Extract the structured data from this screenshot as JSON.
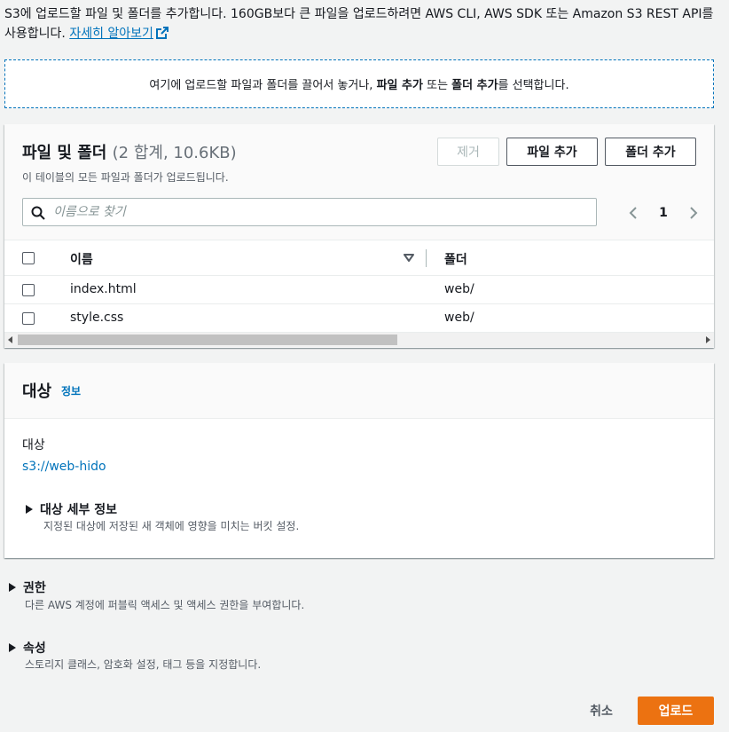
{
  "intro": {
    "text": "S3에 업로드할 파일 및 폴더를 추가합니다. 160GB보다 큰 파일을 업로드하려면 AWS CLI, AWS SDK 또는 Amazon S3 REST API를 사용합니다.",
    "link": "자세히 알아보기"
  },
  "dropzone": {
    "part1": "여기에 업로드할 파일과 폴더를 끌어서 놓거나,",
    "bold1": "파일 추가",
    "part2": "또는",
    "bold2": "폴더 추가",
    "part3": "를 선택합니다."
  },
  "files": {
    "title": "파일 및 폴더",
    "count": "(2 합계, 10.6KB)",
    "subtitle": "이 테이블의 모든 파일과 폴더가 업로드됩니다.",
    "remove_label": "제거",
    "add_file_label": "파일 추가",
    "add_folder_label": "폴더 추가",
    "search_placeholder": "이름으로 찾기",
    "page": "1",
    "columns": {
      "name": "이름",
      "folder": "폴더"
    },
    "rows": [
      {
        "name": "index.html",
        "folder": "web/"
      },
      {
        "name": "style.css",
        "folder": "web/"
      }
    ]
  },
  "destination": {
    "title": "대상",
    "info": "정보",
    "label": "대상",
    "link": "s3://web-hido",
    "details_title": "대상 세부 정보",
    "details_desc": "지정된 대상에 저장된 새 객체에 영향을 미치는 버킷 설정."
  },
  "permissions": {
    "title": "권한",
    "desc": "다른 AWS 계정에 퍼블릭 액세스 및 액세스 권한을 부여합니다."
  },
  "properties": {
    "title": "속성",
    "desc": "스토리지 클래스, 암호화 설정, 태그 등을 지정합니다."
  },
  "footer": {
    "cancel_label": "취소",
    "upload_label": "업로드"
  },
  "colors": {
    "link": "#0073bb",
    "primary": "#ec7211"
  }
}
